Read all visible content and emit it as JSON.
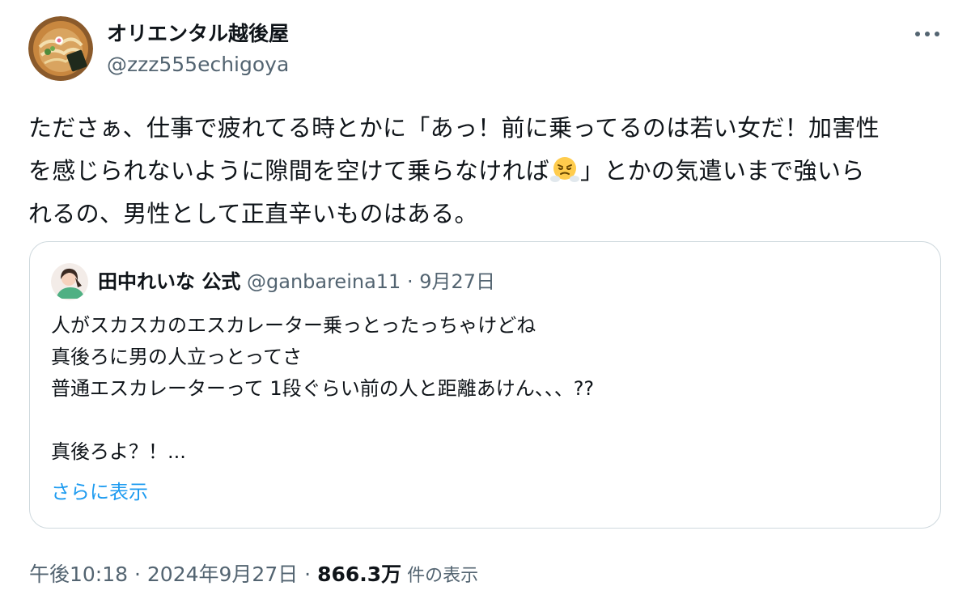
{
  "author": {
    "display_name": "オリエンタル越後屋",
    "handle": "@zzz555echigoya"
  },
  "tweet": {
    "lines": [
      "たださぁ、仕事で疲れてる時とかに「あっ！前に乗ってるのは若い女だ！加害性",
      "を感じられないように隙間を空けて乗らなければ",
      "」とかの気遣いまで強いら",
      "れるの、男性として正直辛いものはある。"
    ],
    "emoji": "face-with-steam-from-nose-icon"
  },
  "quote": {
    "display_name": "田中れいな 公式",
    "handle": "@ganbareina11",
    "separator": "·",
    "date": "9月27日",
    "lines": [
      "人がスカスカのエスカレーター乗っとったっちゃけどね",
      "真後ろに男の人立っとってさ",
      "普通エスカレーターって 1段ぐらい前の人と距離あけん、、、??",
      "",
      "真後ろよ？！..."
    ],
    "show_more": "さらに表示"
  },
  "meta": {
    "time": "午後10:18",
    "sep1": " · ",
    "date": "2024年9月27日",
    "sep2": " · ",
    "views_count": "866.3万",
    "views_label": " 件の表示"
  },
  "colors": {
    "text": "#0f1419",
    "secondary": "#536471",
    "link": "#1d9bf0",
    "border": "#cfd9de"
  }
}
